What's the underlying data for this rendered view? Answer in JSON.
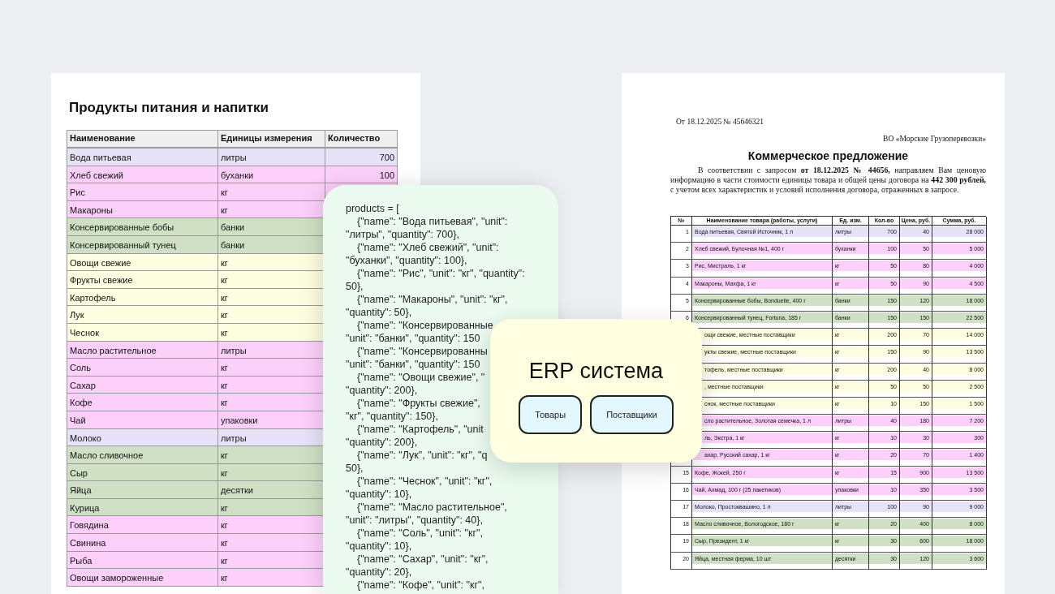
{
  "spreadsheet": {
    "title": "Продукты питания и напитки",
    "columns": [
      "Наименование",
      "Единицы измерения",
      "Количество"
    ],
    "rows": [
      {
        "name": "Вода питьевая",
        "unit": "литры",
        "quantity": "700",
        "color": "#e8e2f8"
      },
      {
        "name": "Хлеб свежий",
        "unit": "буханки",
        "quantity": "100",
        "color": "#fcd0fb"
      },
      {
        "name": "Рис",
        "unit": "кг",
        "color": "#fcd0fb"
      },
      {
        "name": "Макароны",
        "unit": "кг",
        "color": "#fcd0fb"
      },
      {
        "name": "Консервированные бобы",
        "unit": "банки",
        "color": "#cfe0c4"
      },
      {
        "name": "Консервированный тунец",
        "unit": "банки",
        "color": "#cfe0c4"
      },
      {
        "name": "Овощи свежие",
        "unit": "кг",
        "color": "#fdfddf"
      },
      {
        "name": "Фрукты свежие",
        "unit": "кг",
        "color": "#fdfddf"
      },
      {
        "name": "Картофель",
        "unit": "кг",
        "color": "#fdfddf"
      },
      {
        "name": "Лук",
        "unit": "кг",
        "color": "#fdfddf"
      },
      {
        "name": "Чеснок",
        "unit": "кг",
        "color": "#fdfddf"
      },
      {
        "name": "Масло растительное",
        "unit": "литры",
        "color": "#fcd0fb"
      },
      {
        "name": "Соль",
        "unit": "кг",
        "color": "#fcd0fb"
      },
      {
        "name": "Сахар",
        "unit": "кг",
        "color": "#fcd0fb"
      },
      {
        "name": "Кофе",
        "unit": "кг",
        "color": "#fcd0fb"
      },
      {
        "name": "Чай",
        "unit": "упаковки",
        "color": "#fcd0fb"
      },
      {
        "name": "Молоко",
        "unit": "литры",
        "color": "#e8e2f8"
      },
      {
        "name": "Масло сливочное",
        "unit": "кг",
        "color": "#cfe0c4"
      },
      {
        "name": "Сыр",
        "unit": "кг",
        "color": "#cfe0c4"
      },
      {
        "name": "Яйца",
        "unit": "десятки",
        "color": "#cfe0c4"
      },
      {
        "name": "Курица",
        "unit": "кг",
        "color": "#cfe0c4"
      },
      {
        "name": "Говядина",
        "unit": "кг",
        "color": "#fcd0fb"
      },
      {
        "name": "Свинина",
        "unit": "кг",
        "color": "#fcd0fb"
      },
      {
        "name": "Рыба",
        "unit": "кг",
        "color": "#fcd0fb"
      },
      {
        "name": "Овощи замороженные",
        "unit": "кг",
        "color": "#fcd0fb"
      }
    ]
  },
  "code_panel": {
    "lines": [
      {
        "text": "products = [",
        "kind": "start"
      },
      {
        "text": "{\"name\": \"Вода питьевая\", \"unit\":",
        "kind": "entry"
      },
      {
        "text": "\"литры\", \"quantity\": 700},",
        "kind": "wrap"
      },
      {
        "text": "{\"name\": \"Хлеб свежий\", \"unit\":",
        "kind": "entry"
      },
      {
        "text": "\"буханки\", \"quantity\": 100},",
        "kind": "wrap"
      },
      {
        "text": "{\"name\": \"Рис\", \"unit\": \"кг\", \"quantity\":",
        "kind": "entry"
      },
      {
        "text": "50},",
        "kind": "wrap"
      },
      {
        "text": "{\"name\": \"Макароны\", \"unit\": \"кг\",",
        "kind": "entry"
      },
      {
        "text": "\"quantity\": 50},",
        "kind": "wrap"
      },
      {
        "text": "{\"name\": \"Консервированные",
        "kind": "entry"
      },
      {
        "text": "\"unit\": \"банки\", \"quantity\": 150",
        "kind": "wrap"
      },
      {
        "text": "{\"name\": \"Консервированны",
        "kind": "entry"
      },
      {
        "text": "\"unit\": \"банки\", \"quantity\": 150",
        "kind": "wrap"
      },
      {
        "text": "{\"name\": \"Овощи свежие\", \"",
        "kind": "entry"
      },
      {
        "text": "\"quantity\": 200},",
        "kind": "wrap"
      },
      {
        "text": "{\"name\": \"Фрукты свежие\",",
        "kind": "entry"
      },
      {
        "text": "\"кг\", \"quantity\": 150},",
        "kind": "wrap"
      },
      {
        "text": "{\"name\": \"Картофель\", \"unit",
        "kind": "entry"
      },
      {
        "text": "\"quantity\": 200},",
        "kind": "wrap"
      },
      {
        "text": "{\"name\": \"Лук\", \"unit\": \"кг\", \"q",
        "kind": "entry"
      },
      {
        "text": "50},",
        "kind": "wrap"
      },
      {
        "text": "{\"name\": \"Чеснок\", \"unit\": \"кг\",",
        "kind": "entry"
      },
      {
        "text": "\"quantity\": 10},",
        "kind": "wrap"
      },
      {
        "text": "{\"name\": \"Масло растительное\",",
        "kind": "entry"
      },
      {
        "text": "\"unit\": \"литры\", \"quantity\": 40},",
        "kind": "wrap"
      },
      {
        "text": "{\"name\": \"Соль\", \"unit\": \"кг\",",
        "kind": "entry"
      },
      {
        "text": "\"quantity\": 10},",
        "kind": "wrap"
      },
      {
        "text": "{\"name\": \"Сахар\", \"unit\": \"кг\",",
        "kind": "entry"
      },
      {
        "text": "\"quantity\": 20},",
        "kind": "wrap"
      },
      {
        "text": "{\"name\": \"Кофе\", \"unit\": \"кг\",",
        "kind": "entry"
      }
    ]
  },
  "erp": {
    "title": "ERP система",
    "buttons": [
      "Товары",
      "Поставщики"
    ]
  },
  "offer": {
    "ref": "От 18.12.2025  № 45646321",
    "addressee": "ВО «Морские Грузоперевозки»",
    "title": "Коммерческое предложение",
    "paragraph": "В соответствии с запросом **от 18.12.2025 № 44656,** направляем Вам ценовую информацию в части стоимости единицы товара и общей цены договора на **442 300 рублей,** с учетом всех характеристик и условий исполнения договора, отраженных в запросе.",
    "columns": [
      "№",
      "Наименование товара (работы, услуги)",
      "Ед. изм.",
      "Кол-во",
      "Цена, руб.",
      "Сумма, руб."
    ],
    "rows": [
      {
        "num": "1",
        "name": "Вода питьевая, Святой Источник, 1 л",
        "unit": "литры",
        "qty": "700",
        "price": "40",
        "sum": "28 000",
        "color": "#e8e2f8"
      },
      {
        "num": "2",
        "name": "Хлеб свежий, Булочная №1, 400 г",
        "unit": "буханки",
        "qty": "100",
        "price": "50",
        "sum": "5 000",
        "color": "#fcd0fb"
      },
      {
        "num": "3",
        "name": "Рис, Мистраль, 1 кг",
        "unit": "кг",
        "qty": "50",
        "price": "80",
        "sum": "4 000",
        "color": "#fcd0fb"
      },
      {
        "num": "4",
        "name": "Макароны, Махфа, 1 кг",
        "unit": "кг",
        "qty": "50",
        "price": "90",
        "sum": "4 500",
        "color": "#fcd0fb"
      },
      {
        "num": "5",
        "name": "Консервированные бобы, Bonduelle, 400 г",
        "unit": "банки",
        "qty": "150",
        "price": "120",
        "sum": "18 000",
        "color": "#cfe0c4"
      },
      {
        "num": "6",
        "name": "Консервированный тунец, Fortuna, 185 г",
        "unit": "банки",
        "qty": "150",
        "price": "150",
        "sum": "22 500",
        "color": "#cfe0c4"
      },
      {
        "name": "ощи свежие, местные поставщики",
        "unit": "кг",
        "qty": "200",
        "price": "70",
        "sum": "14 000",
        "color": "#fdfddf"
      },
      {
        "name": "укты свежие, местные поставщики",
        "unit": "кг",
        "qty": "150",
        "price": "90",
        "sum": "13 500",
        "color": "#fdfddf"
      },
      {
        "name": "тофель, местные поставщики",
        "unit": "кг",
        "qty": "200",
        "price": "40",
        "sum": "8 000",
        "color": "#fdfddf"
      },
      {
        "name": ", местные поставщики",
        "unit": "кг",
        "qty": "50",
        "price": "50",
        "sum": "2 500",
        "color": "#fdfddf"
      },
      {
        "name": "снок, местные поставщики",
        "unit": "кг",
        "qty": "10",
        "price": "150",
        "sum": "1 500",
        "color": "#fdfddf"
      },
      {
        "name": "сло растительное, Золотая семечка, 1 л",
        "unit": "литры",
        "qty": "40",
        "price": "180",
        "sum": "7 200",
        "color": "#fcd0fb"
      },
      {
        "name": "ль, Экстра, 1 кг",
        "unit": "кг",
        "qty": "10",
        "price": "30",
        "sum": "300",
        "color": "#fcd0fb"
      },
      {
        "name": "ахар, Русский сахар, 1 кг",
        "unit": "кг",
        "qty": "20",
        "price": "70",
        "sum": "1 400",
        "color": "#fcd0fb"
      },
      {
        "num": "15",
        "name": "Кофе, Жокей, 250 г",
        "unit": "кг",
        "qty": "15",
        "price": "900",
        "sum": "13 500",
        "color": "#fcd0fb"
      },
      {
        "num": "16",
        "name": "Чай, Ахмад, 100 г (25 пакетиков)",
        "unit": "упаковки",
        "qty": "10",
        "price": "350",
        "sum": "3 500",
        "color": "#fcd0fb"
      },
      {
        "num": "17",
        "name": "Молоко, Простоквашино, 1 л",
        "unit": "литры",
        "qty": "100",
        "price": "90",
        "sum": "9 000",
        "color": "#e8e2f8"
      },
      {
        "num": "18",
        "name": "Масло сливочное, Вологодское, 180 г",
        "unit": "кг",
        "qty": "20",
        "price": "400",
        "sum": "8 000",
        "color": "#cfe0c4"
      },
      {
        "num": "19",
        "name": "Сыр, Президент, 1 кг",
        "unit": "кг",
        "qty": "30",
        "price": "600",
        "sum": "18 000",
        "color": "#cfe0c4"
      },
      {
        "num": "20",
        "name": "Яйца, местная ферма, 10 шт",
        "unit": "десятки",
        "qty": "30",
        "price": "120",
        "sum": "3 600",
        "color": "#cfe0c4"
      }
    ]
  }
}
